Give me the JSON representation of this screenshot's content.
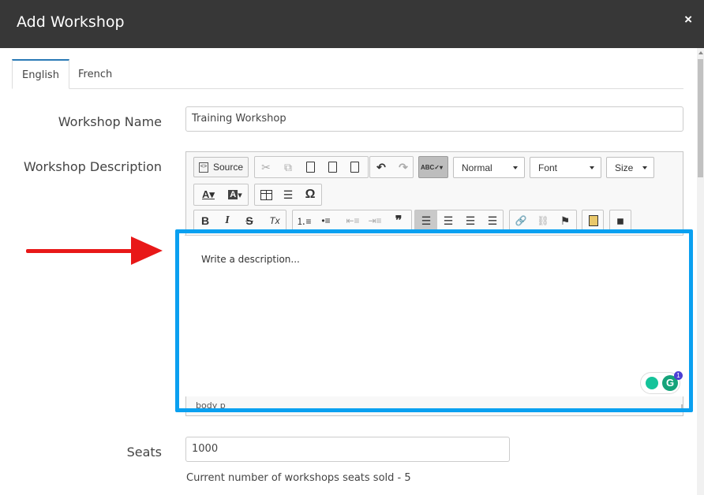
{
  "dialog": {
    "title": "Add Workshop",
    "close_label": "×"
  },
  "tabs": [
    {
      "label": "English",
      "active": true
    },
    {
      "label": "French",
      "active": false
    }
  ],
  "form": {
    "workshop_name_label": "Workshop Name",
    "workshop_name_value": "Training Workshop",
    "workshop_description_label": "Workshop Description",
    "seats_label": "Seats",
    "seats_value": "1000",
    "helper_text": "Current number of workshops seats sold -",
    "helper_value": "5"
  },
  "editor": {
    "source_label": "Source",
    "format_combo": "Normal",
    "font_combo": "Font",
    "size_combo": "Size",
    "placeholder": "Write a description...",
    "path_bar": "body  p",
    "icons": {
      "cut": "✂",
      "copy": "⧉",
      "paste": "📋",
      "undo": "↶",
      "redo": "↷",
      "bold": "B",
      "italic": "I",
      "strike": "S",
      "remove_format": "Tx",
      "quote": "❞",
      "omega": "Ω"
    }
  },
  "colors": {
    "highlight": "#0aa0f0",
    "arrow": "#e81818",
    "titlebar": "#373737",
    "active_tab": "#2a7ab6"
  }
}
